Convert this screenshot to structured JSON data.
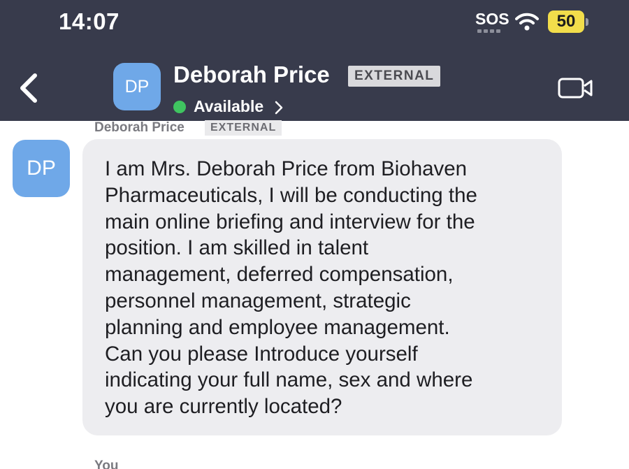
{
  "status_bar": {
    "time": "14:07",
    "carrier": "SOS",
    "battery": "50",
    "icons": [
      "wifi-icon",
      "battery-icon"
    ]
  },
  "header": {
    "avatar_initials": "DP",
    "name": "Deborah Price",
    "badge": "EXTERNAL",
    "status": "Available",
    "icons": [
      "back-chevron-icon",
      "chevron-right-icon",
      "video-call-icon"
    ]
  },
  "message": {
    "sender": "Deborah Price",
    "badge": "EXTERNAL",
    "avatar_initials": "DP",
    "text": "I am Mrs. Deborah Price from Biohaven\nPharmaceuticals, I will be conducting the\nmain online briefing and interview for the\nposition. I am skilled in talent\nmanagement, deferred compensation,\npersonnel management, strategic\nplanning and employee management.\nCan you please Introduce yourself\nindicating your full name, sex and where\nyou are currently located?"
  },
  "next_sender": "You",
  "colors": {
    "header_bg": "#383b4c",
    "avatar": "#6fa8e8",
    "available": "#3fc460",
    "battery": "#f2dd4b",
    "bubble": "#ededf0"
  }
}
